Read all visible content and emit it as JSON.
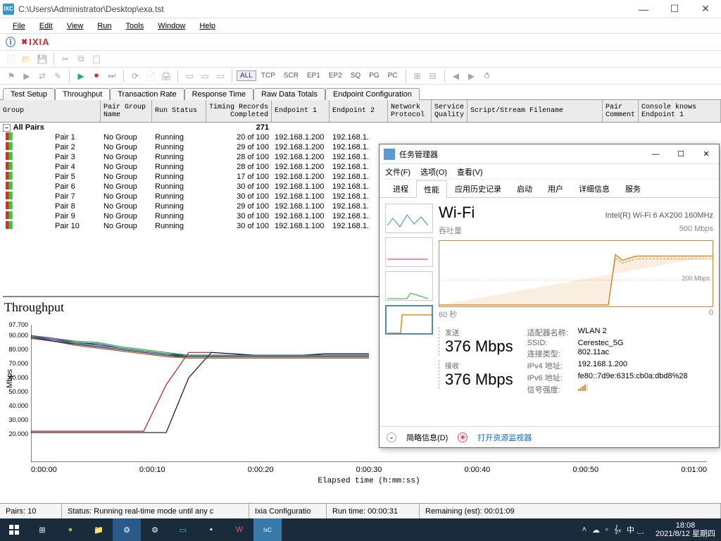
{
  "window": {
    "title": "C:\\Users\\Administrator\\Desktop\\exa.tst",
    "app_icon": "IXC"
  },
  "menubar": [
    "File",
    "Edit",
    "View",
    "Run",
    "Tools",
    "Window",
    "Help"
  ],
  "brand": "IXIA",
  "toolbar_labels": {
    "all": "ALL",
    "tcp": "TCP",
    "scr": "SCR",
    "ep1": "EP1",
    "ep2": "EP2",
    "sq": "SQ",
    "pg": "PG",
    "pc": "PC"
  },
  "tabs": [
    "Test Setup",
    "Throughput",
    "Transaction Rate",
    "Response Time",
    "Raw Data Totals",
    "Endpoint Configuration"
  ],
  "grid_columns": [
    "Group",
    "Pair Group Name",
    "Run Status",
    "Timing Records Completed",
    "Endpoint 1",
    "Endpoint 2",
    "Network Protocol",
    "Service Quality",
    "Script/Stream Filename",
    "Pair Comment",
    "Console knows Endpoint 1"
  ],
  "all_pairs_label": "All Pairs",
  "all_pairs_count": "271",
  "pairs": [
    {
      "name": "Pair 1",
      "group": "No Group",
      "status": "Running",
      "progress": "20 of 100",
      "ep1": "192.168.1.200",
      "ep2": "192.168.1."
    },
    {
      "name": "Pair 2",
      "group": "No Group",
      "status": "Running",
      "progress": "29 of 100",
      "ep1": "192.168.1.200",
      "ep2": "192.168.1."
    },
    {
      "name": "Pair 3",
      "group": "No Group",
      "status": "Running",
      "progress": "28 of 100",
      "ep1": "192.168.1.200",
      "ep2": "192.168.1."
    },
    {
      "name": "Pair 4",
      "group": "No Group",
      "status": "Running",
      "progress": "28 of 100",
      "ep1": "192.168.1.200",
      "ep2": "192.168.1."
    },
    {
      "name": "Pair 5",
      "group": "No Group",
      "status": "Running",
      "progress": "17 of 100",
      "ep1": "192.168.1.200",
      "ep2": "192.168.1."
    },
    {
      "name": "Pair 6",
      "group": "No Group",
      "status": "Running",
      "progress": "30 of 100",
      "ep1": "192.168.1.100",
      "ep2": "192.168.1."
    },
    {
      "name": "Pair 7",
      "group": "No Group",
      "status": "Running",
      "progress": "30 of 100",
      "ep1": "192.168.1.100",
      "ep2": "192.168.1."
    },
    {
      "name": "Pair 8",
      "group": "No Group",
      "status": "Running",
      "progress": "29 of 100",
      "ep1": "192.168.1.100",
      "ep2": "192.168.1."
    },
    {
      "name": "Pair 9",
      "group": "No Group",
      "status": "Running",
      "progress": "30 of 100",
      "ep1": "192.168.1.100",
      "ep2": "192.168.1."
    },
    {
      "name": "Pair 10",
      "group": "No Group",
      "status": "Running",
      "progress": "30 of 100",
      "ep1": "192.168.1.100",
      "ep2": "192.168.1."
    }
  ],
  "statusbar": {
    "pairs": "Pairs: 10",
    "status": "Status: Running real-time mode until any c",
    "config": "Ixia Configuratio",
    "runtime": "Run time: 00:00:31",
    "remaining": "Remaining (est): 00:01:09"
  },
  "taskbar": {
    "ime": "中 ␣",
    "time": "18:08",
    "date": "2021/8/12 星期四"
  },
  "taskmgr": {
    "title": "任务管理器",
    "menu": [
      "文件(F)",
      "选项(O)",
      "查看(V)"
    ],
    "tabs": [
      "进程",
      "性能",
      "应用历史记录",
      "启动",
      "用户",
      "详细信息",
      "服务"
    ],
    "active_tab": 1,
    "heading": "Wi-Fi",
    "adapter": "Intel(R) Wi-Fi 6 AX200 160MHz",
    "graph_label": "吞吐量",
    "graph_max": "500 Mbps",
    "graph_marker": "200 Mbps",
    "graph_time_left": "60 秒",
    "graph_time_right": "0",
    "send_label": "发送",
    "send_val": "376 Mbps",
    "recv_label": "接收",
    "recv_val": "376 Mbps",
    "details": [
      {
        "k": "适配器名称:",
        "v": "WLAN 2"
      },
      {
        "k": "SSID:",
        "v": "Cerestec_5G"
      },
      {
        "k": "连接类型:",
        "v": "802.11ac"
      },
      {
        "k": "IPv4 地址:",
        "v": "192.168.1.200"
      },
      {
        "k": "IPv6 地址:",
        "v": "fe80::7d9e:6315:cb0a:dbd8%28"
      },
      {
        "k": "信号强度:",
        "v": ""
      }
    ],
    "footer_brief": "简略信息(D)",
    "footer_resmon": "打开资源监视器"
  },
  "chart_data": {
    "type": "line",
    "title": "Throughput",
    "xlabel": "Elapsed time (h:mm:ss)",
    "ylabel": "Mbps",
    "ylim": [
      0,
      97.7
    ],
    "y_ticks": [
      97.7,
      90.0,
      80.0,
      70.0,
      60.0,
      50.0,
      40.0,
      30.0,
      20.0
    ],
    "x_ticks": [
      "0:00:00",
      "0:00:10",
      "0:00:20",
      "0:00:30",
      "0:00:40",
      "0:00:50",
      "0:01:00"
    ],
    "x": [
      0,
      2,
      4,
      6,
      8,
      10,
      12,
      14,
      16,
      18,
      20,
      22,
      24,
      26,
      28,
      30
    ],
    "series": [
      {
        "name": "Pair 1",
        "color": "#b22",
        "values": [
          22,
          22,
          22,
          22,
          22,
          22,
          55,
          78,
          78,
          77,
          76,
          76,
          76,
          77,
          77,
          77
        ]
      },
      {
        "name": "Pair 2",
        "color": "#2a2",
        "values": [
          90,
          88,
          86,
          85,
          82,
          80,
          78,
          76,
          76,
          76,
          76,
          76,
          76,
          76,
          76,
          76
        ]
      },
      {
        "name": "Pair 3",
        "color": "#22b",
        "values": [
          89,
          87,
          85,
          84,
          81,
          79,
          77,
          75,
          75,
          75,
          75,
          75,
          75,
          75,
          75,
          75
        ]
      },
      {
        "name": "Pair 4",
        "color": "#aa2",
        "values": [
          88,
          86,
          84,
          82,
          80,
          78,
          76,
          74,
          74,
          74,
          74,
          74,
          74,
          74,
          74,
          74
        ]
      },
      {
        "name": "Pair 5",
        "color": "#111",
        "values": [
          21,
          21,
          21,
          21,
          21,
          21,
          21,
          60,
          78,
          77,
          76,
          76,
          76,
          77,
          77,
          77
        ]
      },
      {
        "name": "Pair 6",
        "color": "#a2a",
        "values": [
          90,
          88,
          85,
          83,
          81,
          79,
          77,
          76,
          76,
          76,
          76,
          76,
          76,
          76,
          76,
          76
        ]
      },
      {
        "name": "Pair 7",
        "color": "#2aa",
        "values": [
          89,
          87,
          84,
          82,
          80,
          78,
          76,
          75,
          75,
          75,
          75,
          75,
          75,
          75,
          75,
          75
        ]
      },
      {
        "name": "Pair 8",
        "color": "#850",
        "values": [
          88,
          86,
          83,
          81,
          79,
          77,
          75,
          74,
          74,
          74,
          74,
          74,
          74,
          74,
          74,
          74
        ]
      },
      {
        "name": "Pair 9",
        "color": "#085",
        "values": [
          90,
          87,
          85,
          83,
          81,
          79,
          77,
          76,
          76,
          76,
          76,
          76,
          76,
          76,
          76,
          76
        ]
      },
      {
        "name": "Pair 10",
        "color": "#508",
        "values": [
          89,
          86,
          84,
          82,
          80,
          78,
          76,
          75,
          75,
          75,
          75,
          75,
          75,
          75,
          75,
          75
        ]
      }
    ]
  }
}
